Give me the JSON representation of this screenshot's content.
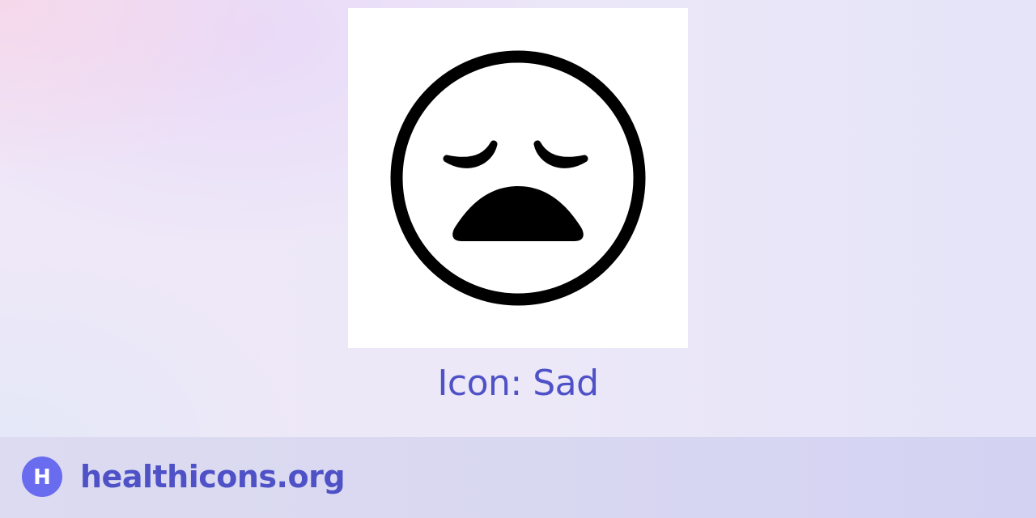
{
  "icon": {
    "title": "Icon: Sad",
    "glyph": "sad-face-icon"
  },
  "footer": {
    "brand": "healthicons.org",
    "logo_letter": "H",
    "logo_icon": "healthicons-logo-icon"
  },
  "colors": {
    "accent": "#4f52c7",
    "logo_bg": "#6a6cf0",
    "icon_stroke": "#000000",
    "card_bg": "#ffffff"
  }
}
